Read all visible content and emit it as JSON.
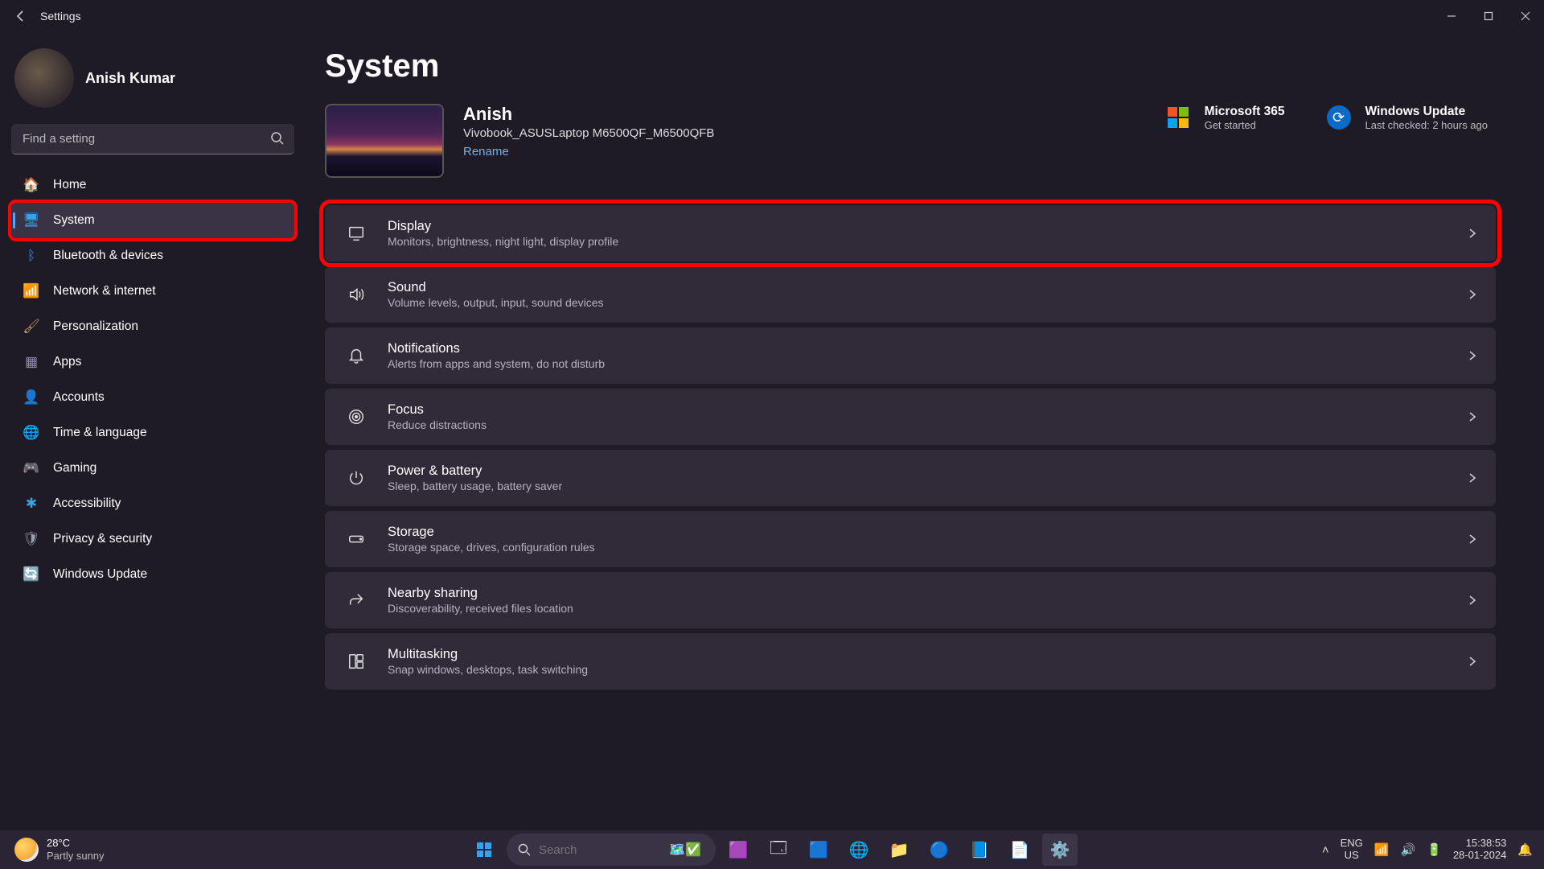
{
  "titlebar": {
    "title": "Settings"
  },
  "user": {
    "name": "Anish Kumar"
  },
  "search": {
    "placeholder": "Find a setting"
  },
  "nav": [
    {
      "id": "home",
      "label": "Home",
      "icon": "🏠",
      "color": "#d9b48a"
    },
    {
      "id": "system",
      "label": "System",
      "icon": "🖥",
      "color": "#3aa0e8",
      "active": true,
      "highlight": true
    },
    {
      "id": "bluetooth",
      "label": "Bluetooth & devices",
      "icon": "ᛒ",
      "color": "#2d8cff"
    },
    {
      "id": "network",
      "label": "Network & internet",
      "icon": "📶",
      "color": "#3aa0e8"
    },
    {
      "id": "personalization",
      "label": "Personalization",
      "icon": "🖌",
      "color": "#c79a6a"
    },
    {
      "id": "apps",
      "label": "Apps",
      "icon": "▦",
      "color": "#9a8ac0"
    },
    {
      "id": "accounts",
      "label": "Accounts",
      "icon": "👤",
      "color": "#3aa0e8"
    },
    {
      "id": "time",
      "label": "Time & language",
      "icon": "🌐",
      "color": "#6ac0a0"
    },
    {
      "id": "gaming",
      "label": "Gaming",
      "icon": "🎮",
      "color": "#8aa0b0"
    },
    {
      "id": "accessibility",
      "label": "Accessibility",
      "icon": "✱",
      "color": "#3aa0e8"
    },
    {
      "id": "privacy",
      "label": "Privacy & security",
      "icon": "🛡",
      "color": "#9aa0b0"
    },
    {
      "id": "update",
      "label": "Windows Update",
      "icon": "🔄",
      "color": "#1a90d0"
    }
  ],
  "main": {
    "heading": "System",
    "device": {
      "name": "Anish",
      "model": "Vivobook_ASUSLaptop M6500QF_M6500QFB",
      "rename": "Rename"
    },
    "quick": {
      "m365": {
        "title": "Microsoft 365",
        "sub": "Get started"
      },
      "update": {
        "title": "Windows Update",
        "sub": "Last checked: 2 hours ago"
      }
    },
    "cards": [
      {
        "id": "display",
        "title": "Display",
        "sub": "Monitors, brightness, night light, display profile",
        "icon": "monitor",
        "highlight": true
      },
      {
        "id": "sound",
        "title": "Sound",
        "sub": "Volume levels, output, input, sound devices",
        "icon": "speaker"
      },
      {
        "id": "notifications",
        "title": "Notifications",
        "sub": "Alerts from apps and system, do not disturb",
        "icon": "bell"
      },
      {
        "id": "focus",
        "title": "Focus",
        "sub": "Reduce distractions",
        "icon": "target"
      },
      {
        "id": "power",
        "title": "Power & battery",
        "sub": "Sleep, battery usage, battery saver",
        "icon": "power"
      },
      {
        "id": "storage",
        "title": "Storage",
        "sub": "Storage space, drives, configuration rules",
        "icon": "drive"
      },
      {
        "id": "sharing",
        "title": "Nearby sharing",
        "sub": "Discoverability, received files location",
        "icon": "share"
      },
      {
        "id": "multitask",
        "title": "Multitasking",
        "sub": "Snap windows, desktops, task switching",
        "icon": "multitask"
      }
    ]
  },
  "taskbar": {
    "weather": {
      "temp": "28°C",
      "desc": "Partly sunny"
    },
    "search": {
      "placeholder": "Search"
    },
    "lang": {
      "l1": "ENG",
      "l2": "US"
    },
    "clock": {
      "time": "15:38:53",
      "date": "28-01-2024"
    }
  }
}
